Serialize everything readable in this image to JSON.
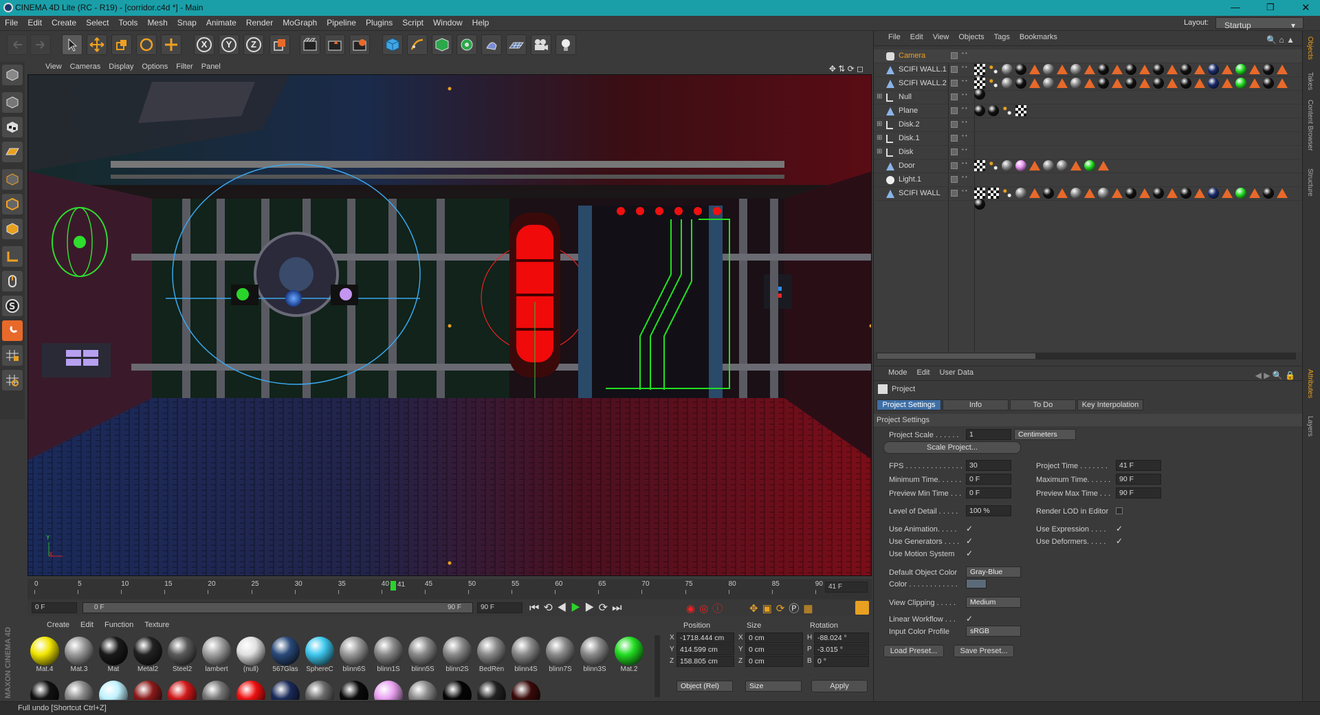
{
  "window": {
    "title": "CINEMA 4D Lite (RC - R19) - [corridor.c4d *] - Main",
    "layout_label": "Layout:",
    "layout_value": "Startup"
  },
  "menu": [
    "File",
    "Edit",
    "Create",
    "Select",
    "Tools",
    "Mesh",
    "Snap",
    "Animate",
    "Render",
    "MoGraph",
    "Pipeline",
    "Plugins",
    "Script",
    "Window",
    "Help"
  ],
  "toolbar_icons": [
    "undo-icon",
    "redo-icon",
    "live-selection-icon",
    "move-icon",
    "scale-icon",
    "rotate-icon",
    "move-cross-icon",
    "x-axis-icon",
    "y-axis-icon",
    "z-axis-icon",
    "coordinate-system-icon",
    "render-view-icon",
    "render-picture-viewer-icon",
    "render-settings-icon",
    "cube-icon",
    "pen-icon",
    "subdivision-icon",
    "array-icon",
    "deformer-icon",
    "floor-icon",
    "camera-icon",
    "light-icon"
  ],
  "axis_labels": [
    "X",
    "Y",
    "Z"
  ],
  "viewport": {
    "menu": [
      "View",
      "Cameras",
      "Display",
      "Options",
      "Filter",
      "Panel"
    ]
  },
  "timeline": {
    "ticks": [
      "0",
      "5",
      "10",
      "15",
      "20",
      "25",
      "30",
      "35",
      "40",
      "45",
      "50",
      "55",
      "60",
      "65",
      "70",
      "75",
      "80",
      "85",
      "90"
    ],
    "current_frame": "41",
    "current_frame_field": "41 F",
    "start_field": "0 F",
    "range_start": "0 F",
    "range_end": "90 F",
    "end_field": "90 F"
  },
  "materials": {
    "menu": [
      "Create",
      "Edit",
      "Function",
      "Texture"
    ],
    "row1": [
      {
        "name": "Mat.4",
        "color": "#f2e600"
      },
      {
        "name": "Mat.3",
        "color": "#9a9a9a"
      },
      {
        "name": "Mat",
        "color": "#1a1a1a"
      },
      {
        "name": "Metal2",
        "color": "#222222"
      },
      {
        "name": "Steel2",
        "color": "#5a5a5a"
      },
      {
        "name": "lambert",
        "color": "#a0a0a0"
      },
      {
        "name": "(null)",
        "color": "#e0e0e0"
      },
      {
        "name": "567Glas",
        "color": "#2a4a7a"
      },
      {
        "name": "SphereC",
        "color": "#3ec8ef"
      },
      {
        "name": "blinn6S",
        "color": "#9a9a9a"
      },
      {
        "name": "blinn1S",
        "color": "#8a8a8a"
      },
      {
        "name": "blinn5S",
        "color": "#8a8a8a"
      },
      {
        "name": "blinn2S",
        "color": "#8a8a8a"
      },
      {
        "name": "BedRen",
        "color": "#8a8a8a"
      },
      {
        "name": "blinn4S",
        "color": "#8a8a8a"
      },
      {
        "name": "blinn7S",
        "color": "#8a8a8a"
      },
      {
        "name": "blinn3S",
        "color": "#8a8a8a"
      },
      {
        "name": "Mat.2",
        "color": "#22dd22"
      }
    ],
    "row2_colors": [
      "#111111",
      "#8a8a8a",
      "#bff2ff",
      "#8a1a1a",
      "#d01818",
      "#777777",
      "#ee1010",
      "#1a2a5a",
      "#6a6a6a",
      "#0a0a0a",
      "#e8a0f0",
      "#8a8a8a",
      "#050505",
      "#222222",
      "#3a0a0a"
    ]
  },
  "coordinates": {
    "headers": [
      "Position",
      "Size",
      "Rotation"
    ],
    "rows": [
      {
        "axis": "X",
        "pos": "-1718.444 cm",
        "size_axis": "X",
        "size": "0 cm",
        "rot_axis": "H",
        "rot": "-88.024 °"
      },
      {
        "axis": "Y",
        "pos": "414.599 cm",
        "size_axis": "Y",
        "size": "0 cm",
        "rot_axis": "P",
        "rot": "-3.015 °"
      },
      {
        "axis": "Z",
        "pos": "158.805 cm",
        "size_axis": "Z",
        "size": "0 cm",
        "rot_axis": "B",
        "rot": "0 °"
      }
    ],
    "mode": "Object (Rel)",
    "size_mode": "Size",
    "apply": "Apply"
  },
  "status": "Full undo [Shortcut Ctrl+Z]",
  "objects": {
    "menu": [
      "File",
      "Edit",
      "View",
      "Objects",
      "Tags",
      "Bookmarks"
    ],
    "items": [
      {
        "name": "Camera",
        "icon": "camera-icon",
        "highlight": true,
        "tags": []
      },
      {
        "name": "SCIFI WALL.1",
        "icon": "polygon-icon",
        "tags": [
          "chk",
          "dots",
          "ball-gray",
          "ball-black",
          "tri",
          "ball-gray",
          "tri",
          "ball-gray",
          "tri",
          "ball-black",
          "tri",
          "ball-black",
          "tri",
          "ball-black",
          "tri",
          "ball-black",
          "tri",
          "ball-navy",
          "tri",
          "ball-green",
          "tri",
          "ball-black",
          "tri",
          "ball-black"
        ]
      },
      {
        "name": "SCIFI WALL.2",
        "icon": "polygon-icon",
        "tags": [
          "chk",
          "dots",
          "ball-gray",
          "ball-black",
          "tri",
          "ball-gray",
          "tri",
          "ball-gray",
          "tri",
          "ball-black",
          "tri",
          "ball-black",
          "tri",
          "ball-black",
          "tri",
          "ball-black",
          "tri",
          "ball-navy",
          "tri",
          "ball-green",
          "tri",
          "ball-black",
          "tri",
          "ball-black"
        ]
      },
      {
        "name": "Null",
        "icon": "null-icon",
        "tags": []
      },
      {
        "name": "Plane",
        "icon": "polygon-icon",
        "tags": [
          "ball-black",
          "ball-black",
          "dots",
          "chk"
        ]
      },
      {
        "name": "Disk.2",
        "icon": "null-icon",
        "tags": []
      },
      {
        "name": "Disk.1",
        "icon": "null-icon",
        "tags": []
      },
      {
        "name": "Disk",
        "icon": "null-icon",
        "tags": []
      },
      {
        "name": "Door",
        "icon": "polygon-icon",
        "tags": [
          "chk",
          "dots",
          "ball-gray",
          "ball-pink",
          "tri",
          "ball-gray",
          "ball-gray",
          "tri",
          "ball-green",
          "tri"
        ]
      },
      {
        "name": "Light.1",
        "icon": "light-icon",
        "tags": []
      },
      {
        "name": "SCIFI WALL",
        "icon": "polygon-icon",
        "tags": [
          "chk",
          "chk",
          "dots",
          "ball-gray",
          "tri",
          "ball-black",
          "tri",
          "ball-gray",
          "tri",
          "ball-gray",
          "tri",
          "ball-black",
          "tri",
          "ball-black",
          "tri",
          "ball-black",
          "tri",
          "ball-navy",
          "tri",
          "ball-green",
          "tri",
          "ball-black",
          "tri",
          "ball-black"
        ]
      }
    ]
  },
  "attributes": {
    "menu": [
      "Mode",
      "Edit",
      "User Data"
    ],
    "title": "Project",
    "tabs": [
      "Project Settings",
      "Info",
      "To Do",
      "Key Interpolation"
    ],
    "section": "Project Settings",
    "project_scale_label": "Project Scale . . . . . .",
    "project_scale": "1",
    "project_scale_unit": "Centimeters",
    "scale_project_btn": "Scale Project...",
    "fps_label": "FPS . . . . . . . . . . . . . .",
    "fps": "30",
    "project_time_label": "Project Time . . . . . . .",
    "project_time": "41 F",
    "min_time_label": "Minimum Time. . . . . .",
    "min_time": "0 F",
    "max_time_label": "Maximum Time. . . . . .",
    "max_time": "90 F",
    "prev_min_label": "Preview Min Time . . .",
    "prev_min": "0 F",
    "prev_max_label": "Preview Max Time . . .",
    "prev_max": "90 F",
    "lod_label": "Level of Detail . . . . .",
    "lod": "100 %",
    "render_lod_label": "Render LOD in Editor",
    "use_animation_label": "Use Animation. . . . .",
    "use_expression_label": "Use Expression . . . .",
    "use_generators_label": "Use Generators . . . .",
    "use_deformers_label": "Use Deformers. . . . .",
    "use_motion_label": "Use Motion System",
    "default_color_label": "Default Object Color",
    "default_color": "Gray-Blue",
    "color_label": "Color . . . . . . . . . . . .",
    "view_clipping_label": "View Clipping . . . . .",
    "view_clipping": "Medium",
    "linear_workflow_label": "Linear Workflow . . .",
    "input_profile_label": "Input Color Profile",
    "input_profile": "sRGB",
    "load_preset": "Load Preset...",
    "save_preset": "Save Preset...",
    "checkmark": "✓"
  },
  "side_tabs": [
    "Objects",
    "Takes",
    "Content Browser",
    "Structure",
    "Attributes",
    "Layers"
  ],
  "viewport_axes": {
    "y": "Y",
    "x": "X"
  },
  "brand": "MAXON CINEMA 4D"
}
